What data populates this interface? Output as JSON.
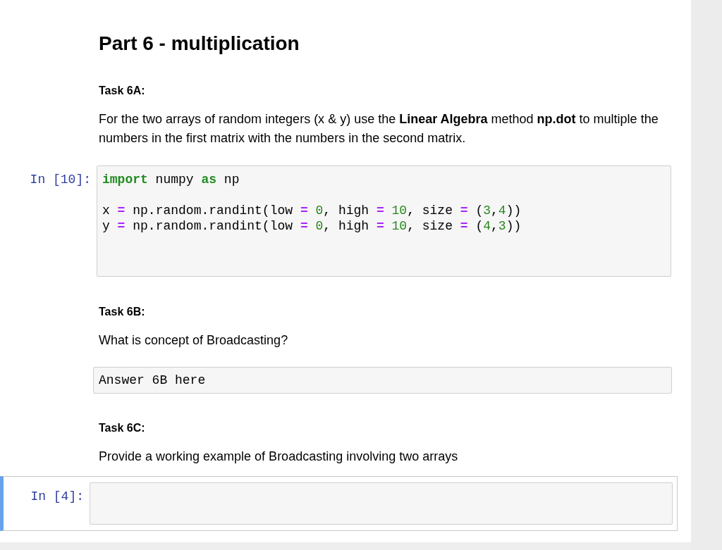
{
  "cells": [
    {
      "kind": "heading",
      "text": "Part 6 - multiplication"
    },
    {
      "kind": "task",
      "text": "Task 6A:"
    },
    {
      "kind": "paragraph",
      "text": "For the two arrays of random integers (x & y) use the **Linear Algebra** method **np.dot** to multiple the numbers in the first matrix with the numbers in the second matrix."
    },
    {
      "kind": "code",
      "prompt": "In [10]:",
      "selected": false,
      "blocks": [
        {
          "lines": [
            {
              "tokens": [
                {
                  "kind": "keyword",
                  "text": "import"
                },
                {
                  "kind": "plain",
                  "text": " numpy "
                },
                {
                  "kind": "keyword",
                  "text": "as"
                },
                {
                  "kind": "plain",
                  "text": " np"
                }
              ]
            }
          ]
        },
        {
          "lines": [
            {
              "tokens": [
                {
                  "kind": "plain",
                  "text": "x "
                },
                {
                  "kind": "operator",
                  "text": "="
                },
                {
                  "kind": "plain",
                  "text": " np.random.randint(low "
                },
                {
                  "kind": "operator",
                  "text": "="
                },
                {
                  "kind": "number",
                  "text": " 0"
                },
                {
                  "kind": "plain",
                  "text": ", high "
                },
                {
                  "kind": "operator",
                  "text": "="
                },
                {
                  "kind": "number",
                  "text": " 10"
                },
                {
                  "kind": "plain",
                  "text": ", size "
                },
                {
                  "kind": "operator",
                  "text": "="
                },
                {
                  "kind": "plain",
                  "text": " ("
                },
                {
                  "kind": "number",
                  "text": "3"
                },
                {
                  "kind": "plain",
                  "text": ","
                },
                {
                  "kind": "number",
                  "text": "4"
                },
                {
                  "kind": "plain",
                  "text": "))"
                }
              ]
            },
            {
              "tokens": [
                {
                  "kind": "plain",
                  "text": "y "
                },
                {
                  "kind": "operator",
                  "text": "="
                },
                {
                  "kind": "plain",
                  "text": " np.random.randint(low "
                },
                {
                  "kind": "operator",
                  "text": "="
                },
                {
                  "kind": "number",
                  "text": " 0"
                },
                {
                  "kind": "plain",
                  "text": ", high "
                },
                {
                  "kind": "operator",
                  "text": "="
                },
                {
                  "kind": "number",
                  "text": " 10"
                },
                {
                  "kind": "plain",
                  "text": ", size "
                },
                {
                  "kind": "operator",
                  "text": "="
                },
                {
                  "kind": "plain",
                  "text": " ("
                },
                {
                  "kind": "number",
                  "text": "4"
                },
                {
                  "kind": "plain",
                  "text": ","
                },
                {
                  "kind": "number",
                  "text": "3"
                },
                {
                  "kind": "plain",
                  "text": "))"
                }
              ]
            }
          ]
        }
      ]
    },
    {
      "kind": "task",
      "text": "Task 6B:"
    },
    {
      "kind": "paragraph",
      "text": "What is concept of Broadcasting?"
    },
    {
      "kind": "raw",
      "text": "Answer 6B here"
    },
    {
      "kind": "task",
      "text": "Task 6C:"
    },
    {
      "kind": "paragraph",
      "text": "Provide a working example of Broadcasting involving two arrays"
    },
    {
      "kind": "code",
      "prompt": "In [4]:",
      "selected": true
    }
  ]
}
